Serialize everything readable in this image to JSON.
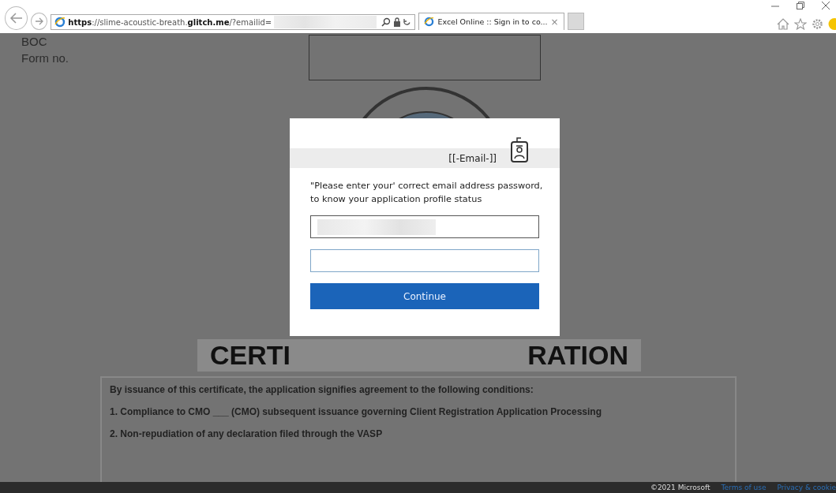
{
  "browser": {
    "url_scheme": "https://",
    "url_host_start": "slime-acoustic-breath.",
    "url_host_domain": "glitch.me",
    "url_path": "/?emailid=",
    "tabs": [
      {
        "title": "Excel Online :: Sign in to co...",
        "close": "×",
        "selected": true
      }
    ]
  },
  "page": {
    "org": "BOC",
    "form_label": "Form no.",
    "heading_left": "CERTI",
    "heading_right": "RATION",
    "intro": "By issuance of this certificate, the application signifies agreement to the following conditions:",
    "conditions": [
      "1. Compliance to CMO ___ (CMO) subsequent issuance governing Client Registration Application Processing",
      "2. Non-repudiation of any declaration filed through the VASP"
    ]
  },
  "dialog": {
    "account": "[[-Email-]]",
    "message": "\"Please enter your' correct email address password, to know your application profile status",
    "button": "Continue"
  },
  "footer": {
    "copyright": "©2021 Microsoft",
    "links": [
      "Terms of use",
      "Privacy & cookie"
    ]
  }
}
